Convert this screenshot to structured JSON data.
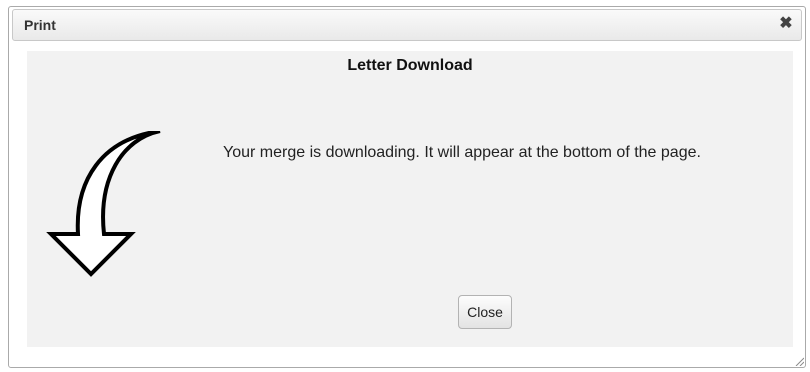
{
  "dialog": {
    "title": "Print",
    "close_icon": "close-icon",
    "close_glyph": "✖",
    "resize_icon": "resize-grip-icon"
  },
  "content": {
    "heading": "Letter Download",
    "message": "Your merge is downloading. It will appear at the bottom of the page.",
    "arrow_icon": "curved-down-arrow-icon",
    "close_label": "Close"
  }
}
